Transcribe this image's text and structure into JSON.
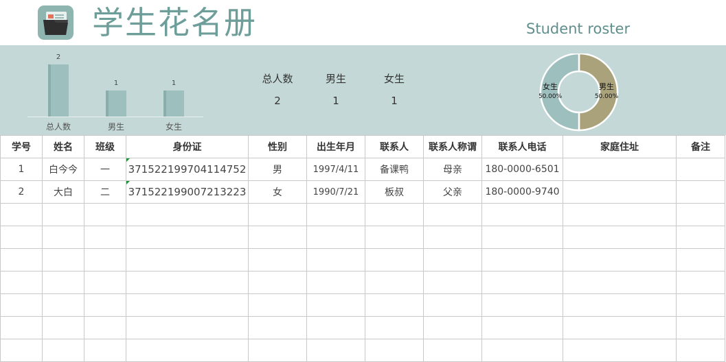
{
  "header": {
    "title": "学生花名册",
    "subtitle": "Student roster",
    "logo_icon": "folder-icon"
  },
  "summary": {
    "chart_data": [
      {
        "type": "bar",
        "categories": [
          "总人数",
          "男生",
          "女生"
        ],
        "values": [
          2,
          1,
          1
        ],
        "data_labels": [
          "2",
          "1",
          "1"
        ],
        "ylim": [
          0,
          2
        ],
        "color": "#9dbfbd"
      },
      {
        "type": "pie",
        "categories": [
          "女生",
          "男生"
        ],
        "values": [
          50,
          50
        ],
        "labels": [
          "50.00%",
          "50.00%"
        ],
        "colors": [
          "#9dbfbd",
          "#a9a27b"
        ],
        "donut": true
      }
    ],
    "stats": [
      {
        "label": "总人数",
        "value": "2"
      },
      {
        "label": "男生",
        "value": "1"
      },
      {
        "label": "女生",
        "value": "1"
      }
    ]
  },
  "table": {
    "headers": [
      "学号",
      "姓名",
      "班级",
      "身份证",
      "性别",
      "出生年月",
      "联系人",
      "联系人称谓",
      "联系人电话",
      "家庭住址",
      "备注"
    ],
    "rows": [
      [
        "1",
        "白今今",
        "一",
        "371522199704114752",
        "男",
        "1997/4/11",
        "备课鸭",
        "母亲",
        "180-0000-6501",
        "",
        ""
      ],
      [
        "2",
        "大白",
        "二",
        "371522199007213223",
        "女",
        "1990/7/21",
        "板叔",
        "父亲",
        "180-0000-9740",
        "",
        ""
      ]
    ],
    "empty_rows": 7
  }
}
